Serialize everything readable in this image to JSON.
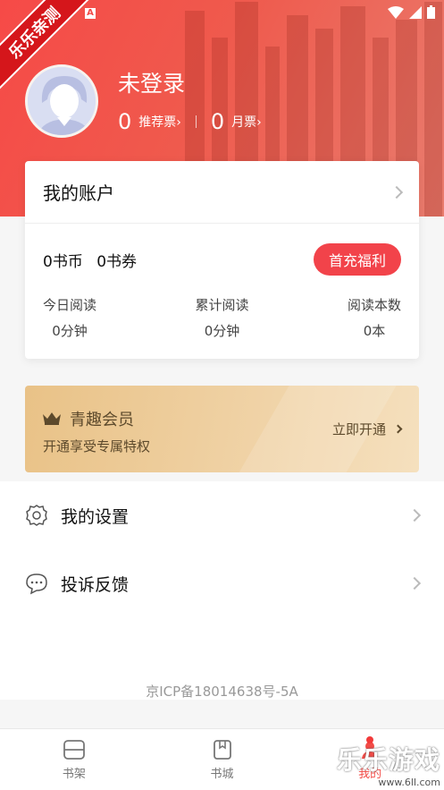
{
  "ribbon": "乐乐亲测",
  "user": {
    "name": "未登录",
    "recommend_count": "0",
    "recommend_label": "推荐票",
    "monthly_count": "0",
    "monthly_label": "月票"
  },
  "account": {
    "title": "我的账户",
    "coins": "0书币",
    "coupons": "0书券",
    "benefit_button": "首充福利",
    "stats": [
      {
        "title": "今日阅读",
        "value": "0分钟"
      },
      {
        "title": "累计阅读",
        "value": "0分钟"
      },
      {
        "title": "阅读本数",
        "value": "0本"
      }
    ]
  },
  "vip": {
    "title": "青趣会员",
    "subtitle": "开通享受专属特权",
    "action": "立即开通"
  },
  "menu": [
    {
      "label": "我的设置",
      "icon": "settings-icon"
    },
    {
      "label": "投诉反馈",
      "icon": "feedback-icon"
    }
  ],
  "icp": "京ICP备18014638号-5A",
  "tabs": [
    {
      "label": "书架",
      "icon": "bookshelf-icon"
    },
    {
      "label": "书城",
      "icon": "bookstore-icon"
    },
    {
      "label": "我的",
      "icon": "profile-icon"
    }
  ],
  "watermark": {
    "big": "乐乐游戏",
    "small": "www.6ll.com"
  },
  "colors": {
    "primary": "#f24b47",
    "vip_gold": "#e9c287"
  }
}
